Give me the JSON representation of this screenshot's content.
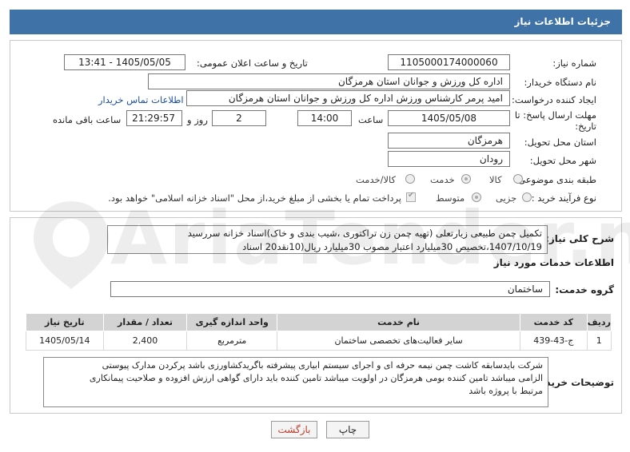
{
  "header": {
    "title": "جزئیات اطلاعات نیاز"
  },
  "form": {
    "need_number_label": "شماره نیاز:",
    "need_number": "1105000174000060",
    "announce_label": "تاریخ و ساعت اعلان عمومی:",
    "announce_value": "1405/05/05 - 13:41",
    "buyer_org_label": "نام دستگاه خریدار:",
    "buyer_org": "اداره کل ورزش و جوانان استان هرمزگان",
    "creator_label": "ایجاد کننده درخواست:",
    "creator": "امید پرمر کارشناس ورزش اداره کل ورزش و جوانان استان هرمزگان",
    "contact_link": "اطلاعات تماس خریدار",
    "deadline_label_1": "مهلت ارسال پاسخ: تا",
    "deadline_label_2": "تاریخ:",
    "deadline_date": "1405/05/08",
    "time_label": "ساعت",
    "deadline_time": "14:00",
    "days_value": "2",
    "days_label": "روز و",
    "remaining_time": "21:29:57",
    "remaining_label": "ساعت باقی مانده",
    "province_label": "استان محل تحویل:",
    "province": "هرمزگان",
    "city_label": "شهر محل تحویل:",
    "city": "رودان",
    "category_label": "طبقه بندی موضوعی:",
    "category_options": [
      "کالا",
      "خدمت",
      "کالا/خدمت"
    ],
    "process_label": "نوع فرآیند خرید :",
    "process_options": [
      "جزیی",
      "متوسط"
    ],
    "payment_note": "پرداخت تمام یا بخشی از مبلغ خرید،از محل \"اسناد خزانه اسلامی\" خواهد بود."
  },
  "description": {
    "label": "شرح کلی نیاز:",
    "line1": "تکمیل چمن طبیعی زیارتعلی  (تهیه چمن زن تراکتوری ،شیب بندی و خاک)اسناد خزانه سررسید",
    "line2": "1407/10/19،تخصیص 30میلیارد اعتبار مصوب 30میلیارد ریال(10نقد20 اسناد"
  },
  "services": {
    "section_title": "اطلاعات خدمات مورد نیاز",
    "group_label": "گروه خدمت:",
    "group_value": "ساختمان",
    "columns": [
      "ردیف",
      "کد خدمت",
      "نام خدمت",
      "واحد اندازه گیری",
      "تعداد / مقدار",
      "تاریخ نیاز"
    ],
    "rows": [
      {
        "index": "1",
        "code": "ج-43-439",
        "name": "سایر فعالیت‌های تخصصی ساختمان",
        "unit": "مترمربع",
        "qty": "2,400",
        "date": "1405/05/14"
      }
    ]
  },
  "buyer_notes": {
    "label": "توضیحات خریدار:",
    "line1": "شرکت بایدسابقه کاشت چمن نیمه حرفه ای و اجرای سیستم ابیاری پیشرفته باگریدکشاورزی باشد پرکردن مدارک پیوستی",
    "line2": "الزامی میباشد تامین کننده بومی هرمزگان در اولویت میباشد تامین کننده باید دارای گواهی ارزش افزوده و صلاحیت پیمانکاری",
    "line3": "مرتبط با پروژه باشد"
  },
  "buttons": {
    "print": "چاپ",
    "back": "بازگشت"
  },
  "colors": {
    "header_bg": "#3f73a8",
    "link": "#1a4fa0",
    "back_text": "#c0392b"
  }
}
